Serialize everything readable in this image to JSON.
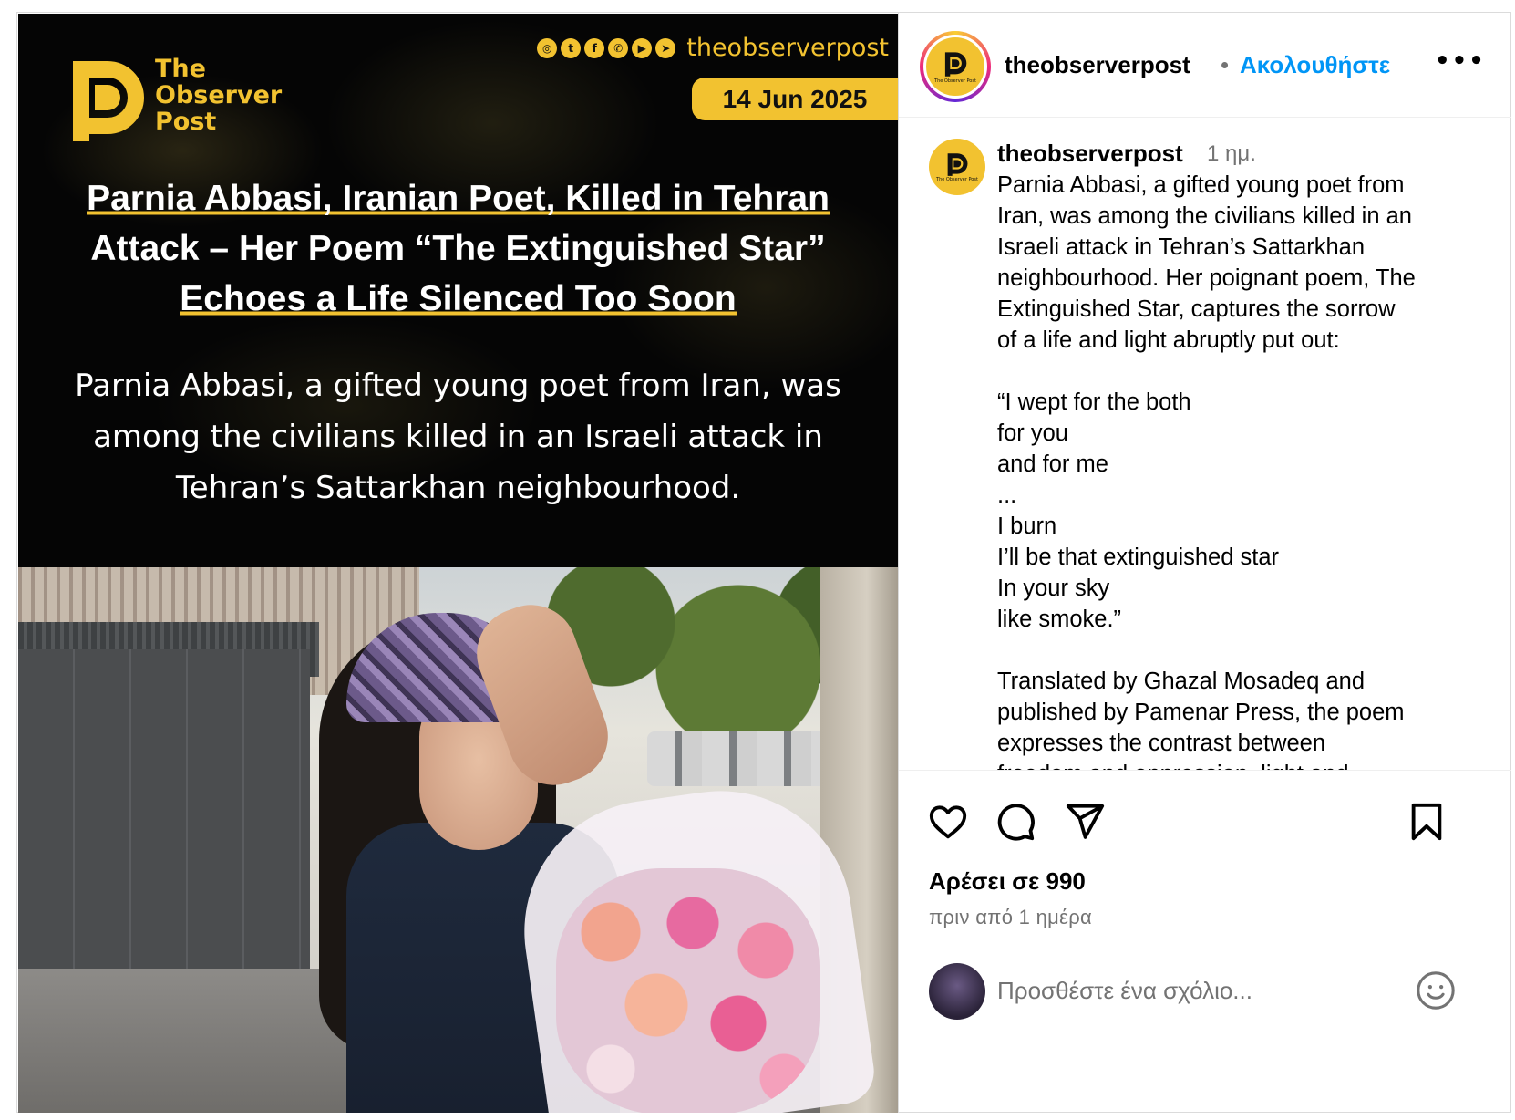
{
  "graphic": {
    "brand_lines": [
      "The",
      "Observer",
      "Post"
    ],
    "handle": "theobserverpost",
    "date": "14 Jun 2025",
    "social_icons": [
      "instagram-icon",
      "twitter-icon",
      "facebook-icon",
      "whatsapp-icon",
      "youtube-icon",
      "telegram-icon"
    ],
    "headline_lines": [
      "Parnia Abbasi, Iranian Poet, Killed in Tehran",
      "Attack – Her Poem “The Extinguished Star”",
      "Echoes a Life Silenced Too Soon"
    ],
    "subhead_lines": [
      "Parnia Abbasi, a gifted young poet from Iran, was",
      "among the civilians killed in an Israeli attack in",
      "Tehran’s Sattarkhan neighbourhood."
    ],
    "accent_color": "#f2c230",
    "avatar_caption": "The Observer Post"
  },
  "header": {
    "username": "theobserverpost",
    "separator": "•",
    "follow_label": "Ακολουθήστε",
    "more_label": "•••"
  },
  "caption": {
    "username": "theobserverpost",
    "time": "1 ημ.",
    "paragraphs": [
      "Parnia Abbasi, a gifted young poet from\nIran, was among the civilians killed in an\nIsraeli attack in Tehran’s Sattarkhan\nneighbourhood. Her poignant poem, The\nExtinguished Star, captures the sorrow\nof a life and light abruptly put out:",
      "“I wept for the both\nfor you\nand for me\n...\nI burn\nI’ll be that extinguished star\nIn your sky\nlike smoke.”",
      "Translated by Ghazal Mosadeq and\npublished by Pamenar Press, the poem\nexpresses the contrast between\nfreedom and oppression, light and"
    ]
  },
  "actions": {
    "likes": "Αρέσει σε 990",
    "posted": "πριν από 1 ημέρα",
    "comment_placeholder": "Προσθέστε ένα σχόλιο..."
  }
}
